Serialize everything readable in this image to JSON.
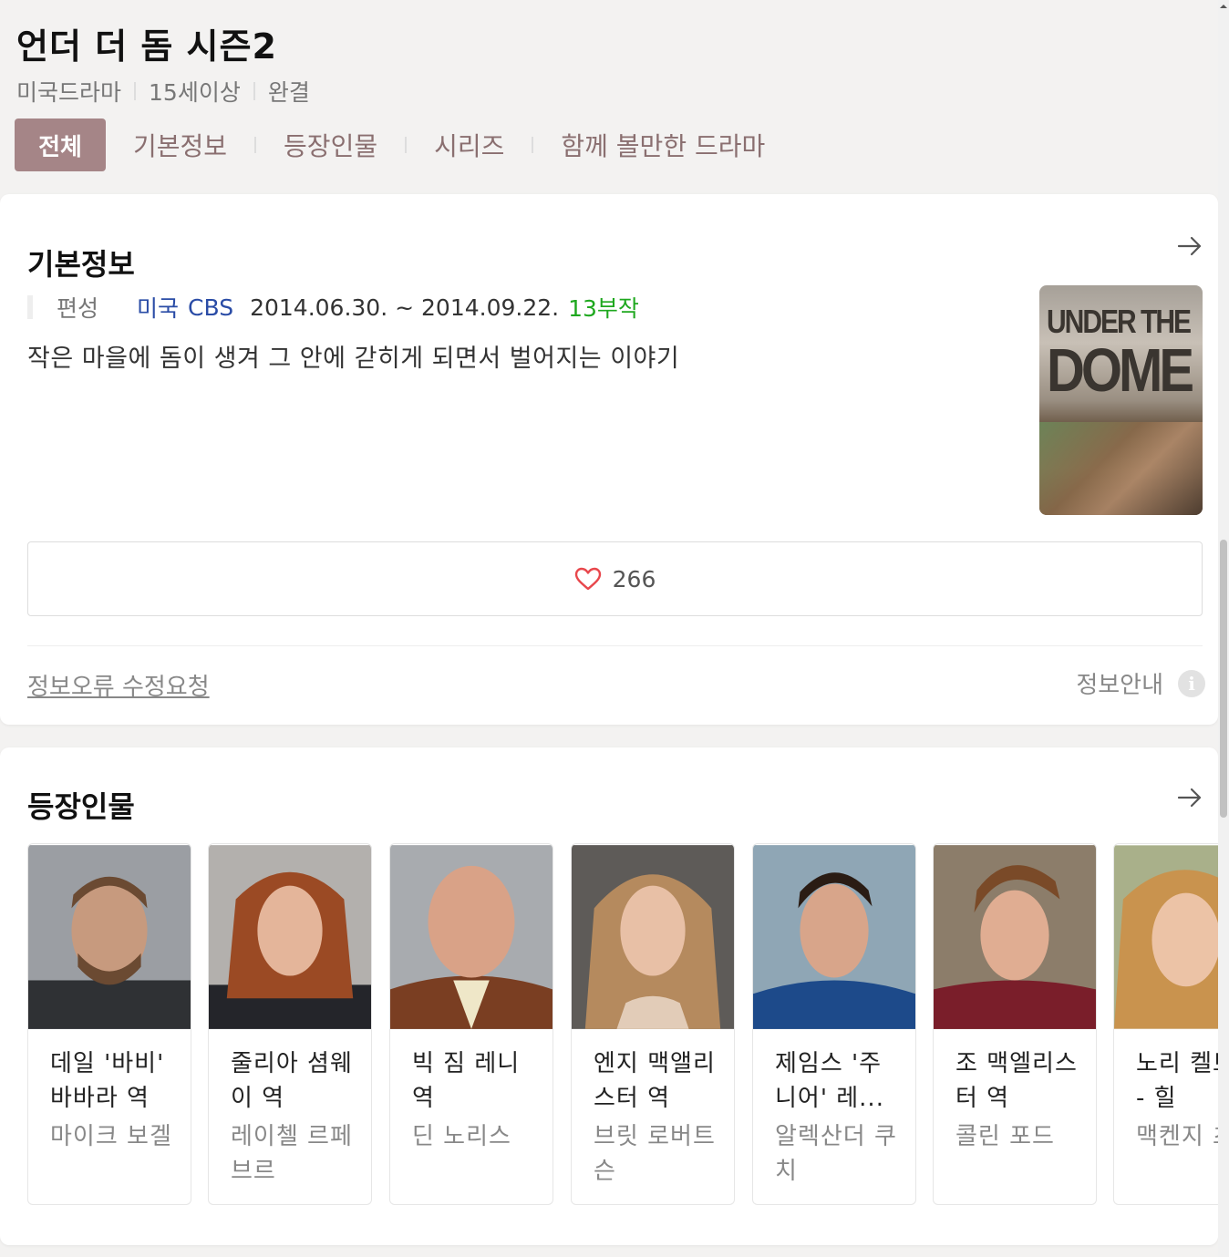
{
  "header": {
    "title": "언더 더 돔 시즌2",
    "meta": [
      "미국드라마",
      "15세이상",
      "완결"
    ]
  },
  "tabs": [
    {
      "label": "전체",
      "active": true
    },
    {
      "label": "기본정보"
    },
    {
      "label": "등장인물"
    },
    {
      "label": "시리즈"
    },
    {
      "label": "함께 볼만한 드라마"
    }
  ],
  "basic_info": {
    "title": "기본정보",
    "label": "편성",
    "country": "미국",
    "channel": "CBS",
    "dates": "2014.06.30. ~ 2014.09.22.",
    "episodes": "13부작",
    "synopsis": "작은 마을에 돔이 생겨 그 안에 갇히게 되면서 벌어지는 이야기",
    "poster_text": [
      "UNDER THE",
      "DOME"
    ],
    "likes": "266",
    "report_link": "정보오류 수정요청",
    "info_guide": "정보안내"
  },
  "cast": {
    "title": "등장인물",
    "items": [
      {
        "role": "데일 '바비' 바바라 역",
        "actor": "마이크 보겔"
      },
      {
        "role": "줄리아 셤웨이 역",
        "actor": "레이첼 르페브르"
      },
      {
        "role": "빅 짐 레니 역",
        "actor": "딘 노리스"
      },
      {
        "role": "엔지 맥앨리스터 역",
        "actor": "브릿 로버트슨"
      },
      {
        "role": "제임스 '주니어' 레...",
        "actor": "알렉산더 쿠치"
      },
      {
        "role": "조 맥엘리스터 역",
        "actor": "콜린 포드"
      },
      {
        "role": "노리 켈트 - 힐",
        "actor": "맥켄지 츠"
      }
    ]
  },
  "colors": {
    "accent": "#a58587",
    "link_blue": "#2a4ca6",
    "episodes_green": "#1fa81f",
    "heart_red": "#e8474c"
  }
}
